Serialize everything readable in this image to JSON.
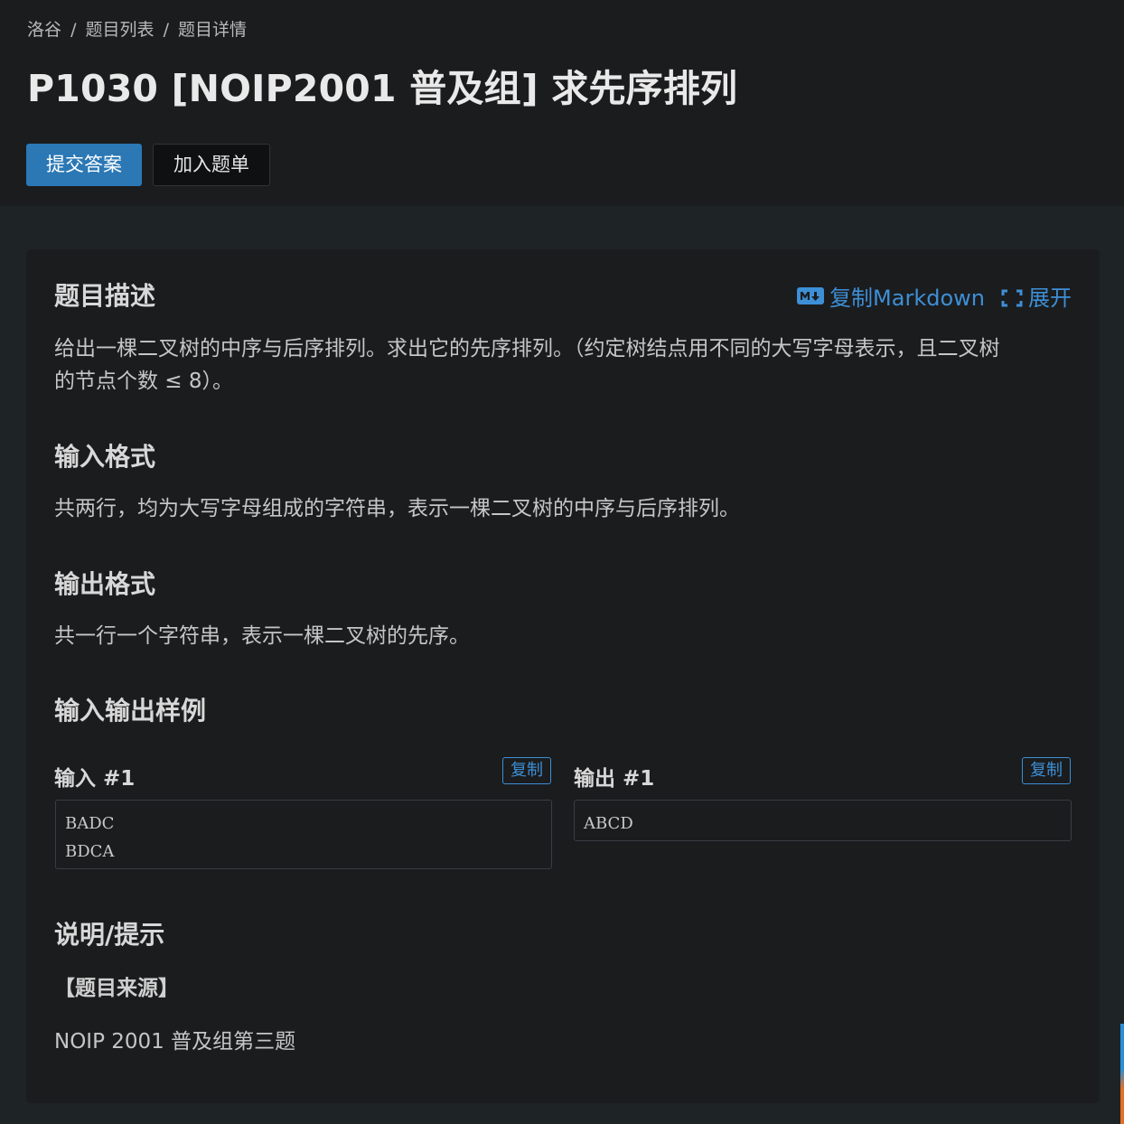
{
  "breadcrumb": {
    "items": [
      "洛谷",
      "题目列表",
      "题目详情"
    ],
    "separator": "/"
  },
  "problem": {
    "title": "P1030 [NOIP2001 普及组] 求先序排列"
  },
  "buttons": {
    "submit_label": "提交答案",
    "add_label": "加入题单"
  },
  "actions": {
    "copy_markdown_label": "复制Markdown",
    "expand_label": "展开"
  },
  "sections": {
    "description_title": "题目描述",
    "description_line1": "给出一棵二叉树的中序与后序排列。求出它的先序排列。（约定树结点用不同的大写字母表示，且二叉树",
    "description_line2": "的节点个数 ≤ 8）。",
    "input_title": "输入格式",
    "input_text": "共两行，均为大写字母组成的字符串，表示一棵二叉树的中序与后序排列。",
    "output_title": "输出格式",
    "output_text": "共一行一个字符串，表示一棵二叉树的先序。",
    "samples_title": "输入输出样例",
    "hint_title": "说明/提示"
  },
  "samples": {
    "input_label": "输入 #1",
    "output_label": "输出 #1",
    "copy_label": "复制",
    "input_lines": [
      "BADC",
      "BDCA"
    ],
    "output_lines": [
      "ABCD"
    ]
  },
  "hint": {
    "source_label": "【题目来源】",
    "source_text": "NOIP 2001 普及组第三题"
  },
  "colors": {
    "accent": "#3d8fd6",
    "submit_bg": "#2b78b5",
    "background": "#1e2325",
    "panel": "#1b1c1e"
  }
}
